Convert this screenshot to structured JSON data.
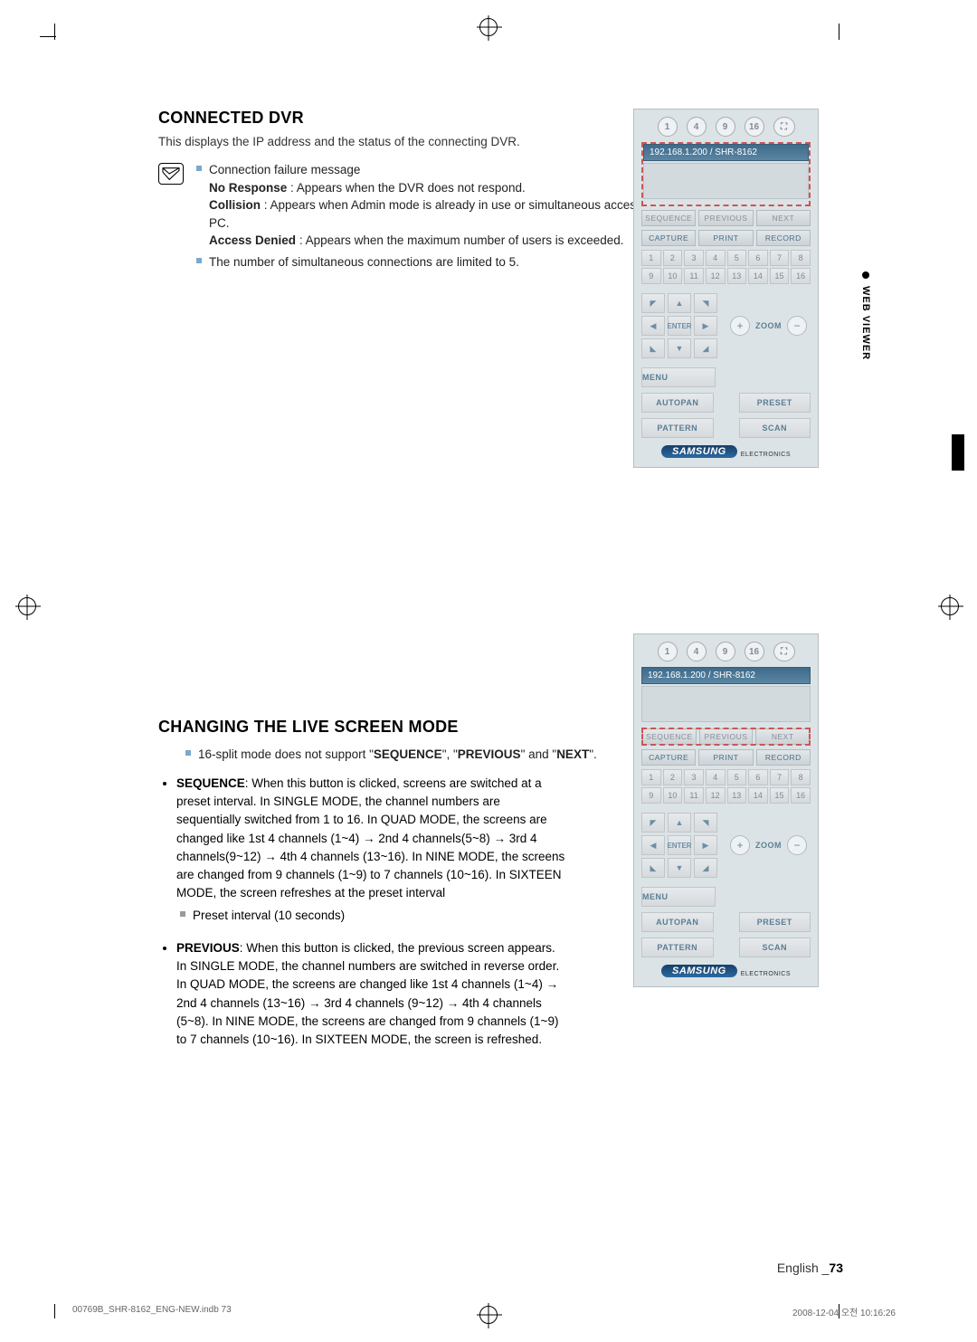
{
  "section1": {
    "title": "CONNECTED DVR",
    "intro": "This displays the IP address and the status of the connecting DVR.",
    "note_lines": [
      "Connection failure message",
      "No Response : Appears when the DVR does not respond.",
      "Collision : Appears when Admin mode is already in use or simultaneous access to the same DVR from another PC.",
      "Access Denied : Appears when the maximum number of users is exceeded.",
      "The number of simultaneous connections are limited to 5."
    ],
    "bold_labels": {
      "no_response": "No Response",
      "collision": "Collision",
      "access_denied": "Access Denied"
    }
  },
  "section2": {
    "title": "CHANGING THE LIVE SCREEN MODE",
    "note_line": "16-split mode does not support \"SEQUENCE\", \"PREVIOUS\" and \"NEXT\".",
    "bold_words": {
      "sequence": "SEQUENCE",
      "previous": "PREVIOUS",
      "next": "NEXT"
    },
    "bullets": [
      {
        "lead": "SEQUENCE",
        "text": ": When this button is clicked, screens are switched at a preset interval. In SINGLE MODE, the channel numbers are sequentially switched from 1 to 16. In QUAD MODE, the screens are changed like 1st 4 channels (1~4) → 2nd 4 channels(5~8) → 3rd 4 channels(9~12) → 4th 4 channels (13~16). In NINE MODE, the screens are changed from 9 channels (1~9) to 7 channels (10~16). In SIXTEEN MODE, the screen refreshes at the preset interval",
        "sub": "Preset interval (10 seconds)"
      },
      {
        "lead": "PREVIOUS",
        "text": ": When this button is clicked, the previous screen appears. In SINGLE MODE, the channel numbers are switched in reverse order. In QUAD MODE, the screens are changed like 1st 4 channels (1~4) → 2nd 4 channels (13~16) → 3rd 4 channels (9~12) → 4th 4 channels (5~8). In NINE MODE, the screens are changed from 9 channels (1~9) to 7 channels (10~16). In SIXTEEN MODE, the screen is refreshed."
      }
    ]
  },
  "panel": {
    "top_icons": [
      "1",
      "4",
      "9",
      "16"
    ],
    "ip": "192.168.1.200",
    "model": "/ SHR-8162",
    "row1": [
      "SEQUENCE",
      "PREVIOUS",
      "NEXT"
    ],
    "row2": [
      "CAPTURE",
      "PRINT",
      "RECORD"
    ],
    "numbers": [
      "1",
      "2",
      "3",
      "4",
      "5",
      "6",
      "7",
      "8",
      "9",
      "10",
      "11",
      "12",
      "13",
      "14",
      "15",
      "16"
    ],
    "dpad_enter": "ENTER",
    "zoom": "ZOOM",
    "menu": "MENU",
    "autopan": "AUTOPAN",
    "preset": "PRESET",
    "pattern": "PATTERN",
    "scan": "SCAN",
    "brand": "SAMSUNG",
    "brand_sub": "ELECTRONICS"
  },
  "side_tab": "WEB VIEWER",
  "footer": {
    "lang": "English _",
    "page": "73"
  },
  "printinfo": {
    "left": "00769B_SHR-8162_ENG-NEW.indb   73",
    "right": "2008-12-04   오전 10:16:26"
  }
}
